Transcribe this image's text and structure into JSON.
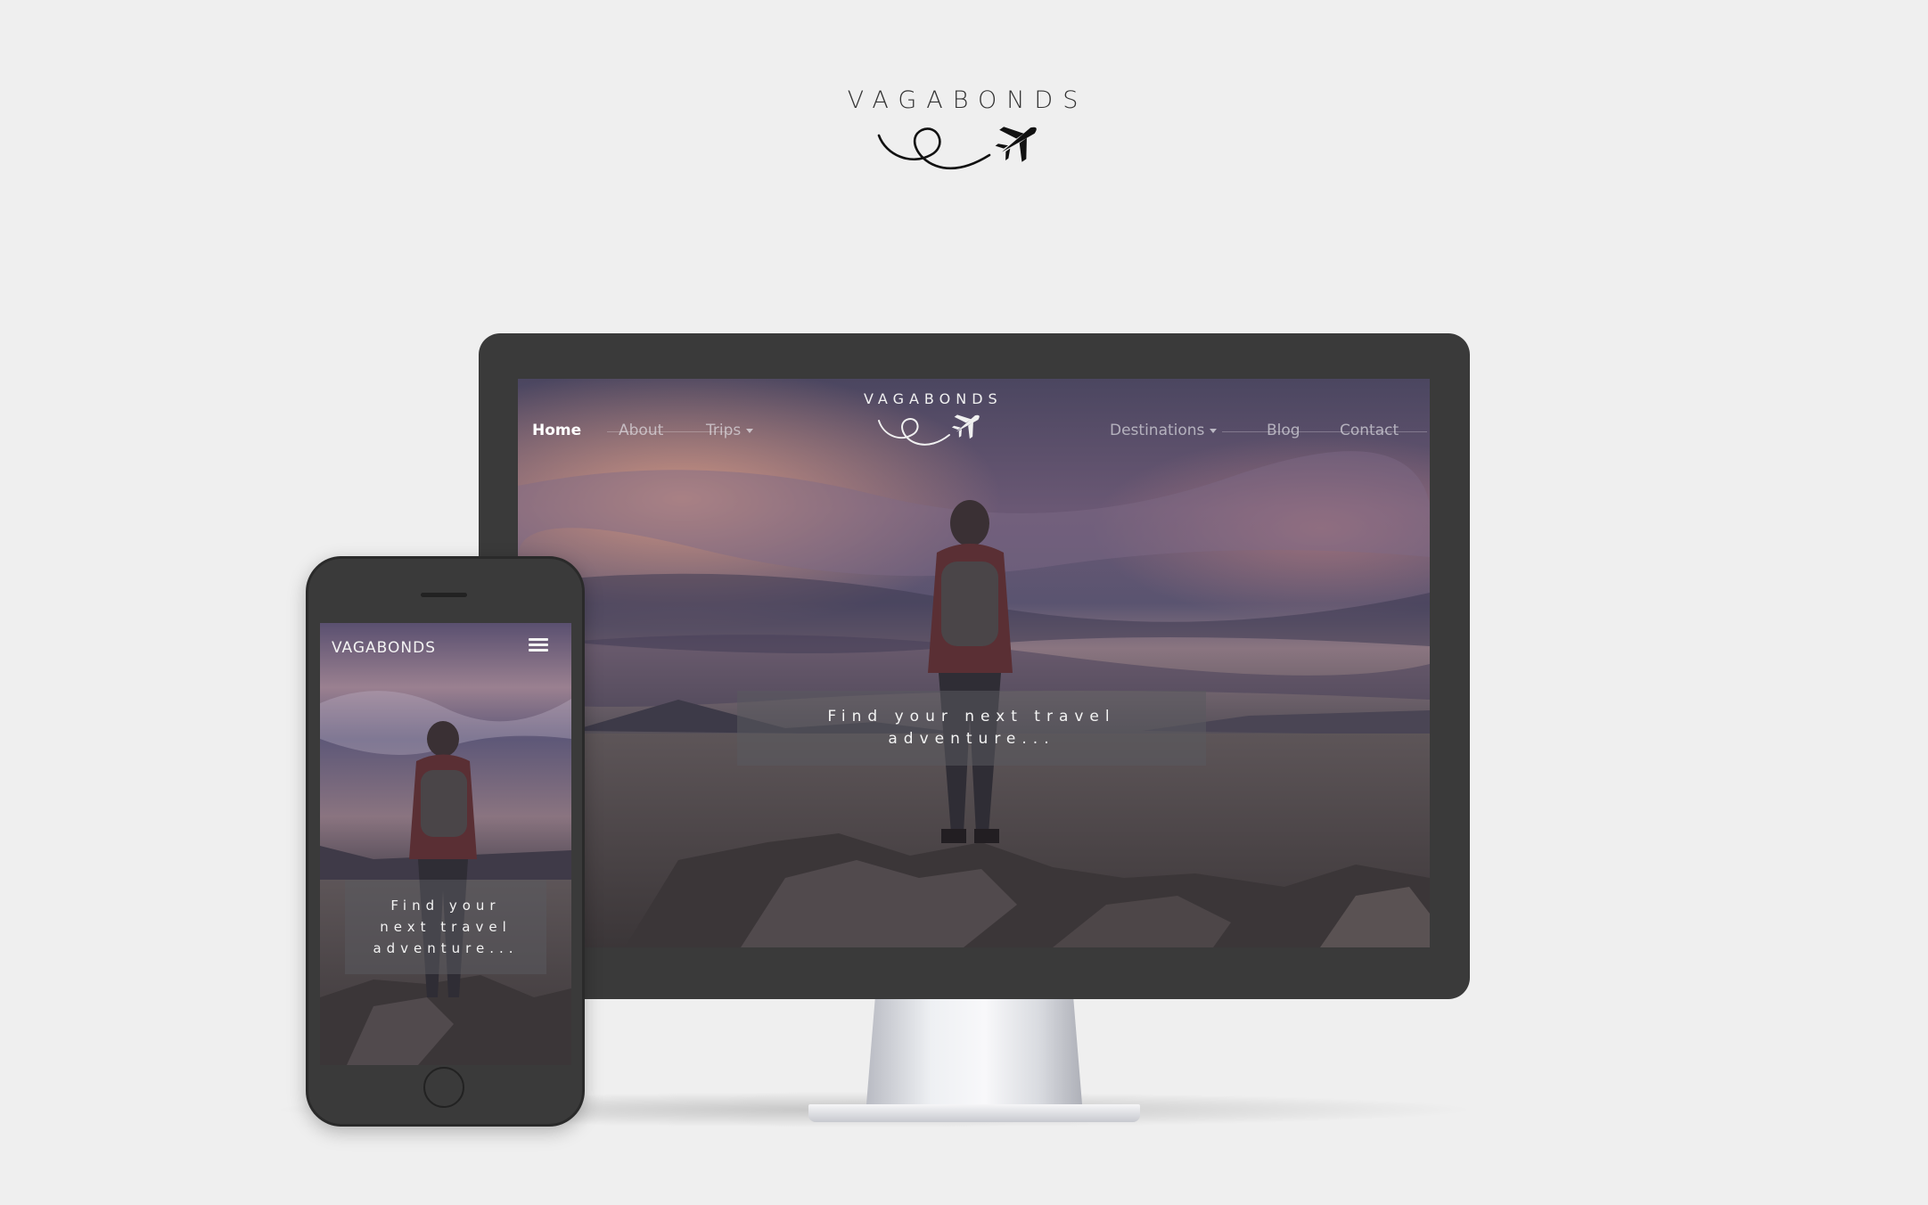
{
  "brand": {
    "name": "VAGABONDS"
  },
  "desktop": {
    "nav_left": [
      {
        "label": "Home",
        "active": true
      },
      {
        "label": "About"
      },
      {
        "label": "Trips",
        "dropdown": true
      }
    ],
    "nav_right": [
      {
        "label": "Destinations",
        "dropdown": true
      },
      {
        "label": "Blog"
      },
      {
        "label": "Contact"
      }
    ],
    "logo_text": "VAGABONDS",
    "hero_text": "Find your next travel adventure..."
  },
  "mobile": {
    "brand": "VAGABONDS",
    "menu_icon": "hamburger-icon",
    "hero_text": "Find your next travel adventure..."
  },
  "colors": {
    "background": "#efefef",
    "device_frame": "#3a3a3a",
    "hero_overlay": "rgba(90,90,95,0.55)",
    "nav_text": "#f0f0f0"
  }
}
